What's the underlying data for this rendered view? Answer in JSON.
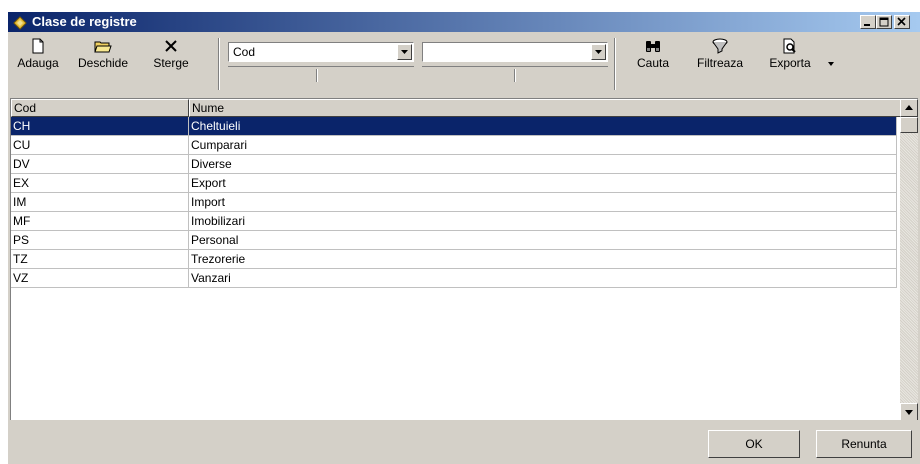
{
  "window": {
    "title": "Clase de registre"
  },
  "toolbar": {
    "add_label": "Adauga",
    "open_label": "Deschide",
    "delete_label": "Sterge",
    "field_combo_value": "Cod",
    "value_combo_value": "",
    "search_label": "Cauta",
    "filter_label": "Filtreaza",
    "export_label": "Exporta"
  },
  "grid": {
    "columns": [
      "Cod",
      "Nume"
    ],
    "rows": [
      {
        "cod": "CH",
        "nume": "Cheltuieli",
        "selected": true
      },
      {
        "cod": "CU",
        "nume": "Cumparari"
      },
      {
        "cod": "DV",
        "nume": "Diverse"
      },
      {
        "cod": "EX",
        "nume": "Export"
      },
      {
        "cod": "IM",
        "nume": "Import"
      },
      {
        "cod": "MF",
        "nume": "Imobilizari"
      },
      {
        "cod": "PS",
        "nume": "Personal"
      },
      {
        "cod": "TZ",
        "nume": "Trezorerie"
      },
      {
        "cod": "VZ",
        "nume": "Vanzari"
      }
    ]
  },
  "footer": {
    "ok_label": "OK",
    "cancel_label": "Renunta"
  },
  "colors": {
    "title_bar_start": "#0a246a",
    "title_bar_end": "#a6caf0",
    "selection": "#0a246a",
    "face": "#d4d0c8"
  }
}
